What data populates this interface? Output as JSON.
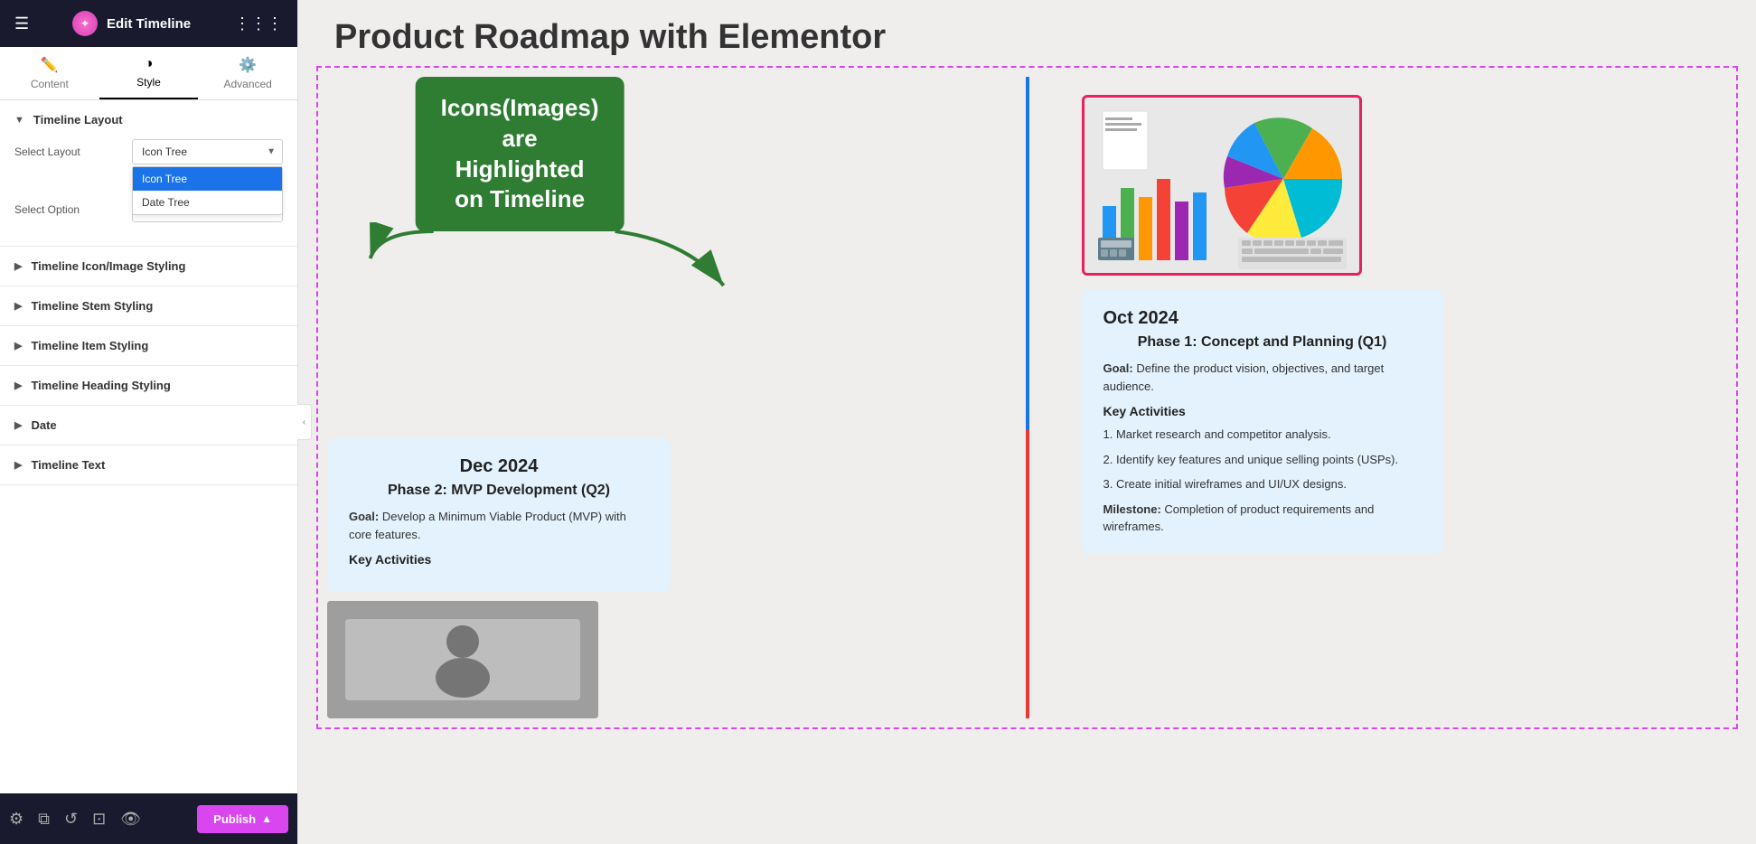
{
  "panel": {
    "title": "Edit Timeline",
    "tabs": [
      {
        "id": "content",
        "label": "Content",
        "icon": "✏️"
      },
      {
        "id": "style",
        "label": "Style",
        "icon": "◑",
        "active": true
      },
      {
        "id": "advanced",
        "label": "Advanced",
        "icon": "⚙️"
      }
    ]
  },
  "sidebar": {
    "sections": [
      {
        "id": "timeline-layout",
        "label": "Timeline Layout",
        "expanded": true,
        "fields": [
          {
            "label": "Select Layout",
            "type": "select",
            "value": "Icon Tree",
            "options": [
              "Icon Tree",
              "Date Tree"
            ]
          },
          {
            "label": "Select Option",
            "type": "select",
            "value": "",
            "options": []
          }
        ]
      },
      {
        "id": "icon-image-styling",
        "label": "Timeline Icon/Image Styling",
        "expanded": false
      },
      {
        "id": "stem-styling",
        "label": "Timeline Stem Styling",
        "expanded": false
      },
      {
        "id": "item-styling",
        "label": "Timeline Item Styling",
        "expanded": false
      },
      {
        "id": "heading-styling",
        "label": "Timeline Heading Styling",
        "expanded": false
      },
      {
        "id": "date",
        "label": "Date",
        "expanded": false
      },
      {
        "id": "timeline-text",
        "label": "Timeline Text",
        "expanded": false
      }
    ],
    "dropdown": {
      "visible": true,
      "options": [
        {
          "label": "Icon Tree",
          "selected": true
        },
        {
          "label": "Date Tree",
          "selected": false
        }
      ]
    }
  },
  "bottom_bar": {
    "publish_label": "Publish"
  },
  "main": {
    "page_title": "Product Roadmap with Elementor",
    "callout": {
      "text": "Icons(Images) are Highlighted on Timeline"
    },
    "timeline": {
      "item1": {
        "date": "Oct 2024",
        "phase": "Phase 1: Concept and Planning (Q1)",
        "goal_label": "Goal:",
        "goal_text": "Define the product vision, objectives, and target audience.",
        "key_activities_label": "Key Activities",
        "activities": [
          "1. Market research and competitor analysis.",
          "2. Identify key features and unique selling points (USPs).",
          "3. Create initial wireframes and UI/UX designs."
        ],
        "milestone_label": "Milestone:",
        "milestone_text": "Completion of product requirements and wireframes."
      },
      "item2": {
        "date": "Dec 2024",
        "phase": "Phase 2: MVP Development (Q2)",
        "goal_label": "Goal:",
        "goal_text": "Develop a Minimum Viable Product (MVP) with core features.",
        "key_activities_label": "Key Activities"
      }
    }
  }
}
